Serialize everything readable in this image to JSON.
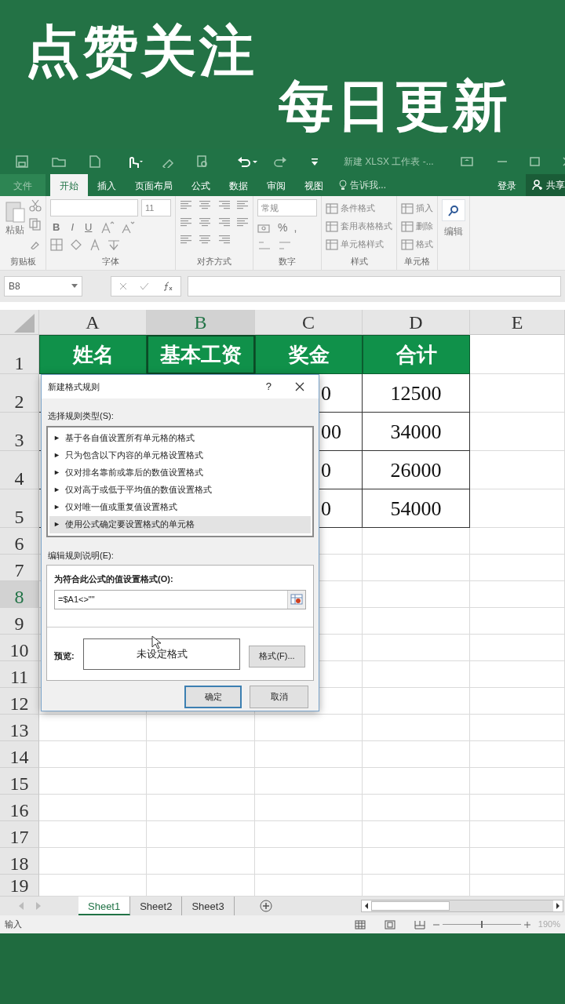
{
  "banner": {
    "lines": [
      "点赞关注",
      "每日更新"
    ]
  },
  "title_bar": {
    "title": "新建 XLSX 工作表 -..."
  },
  "ribbon_tabs": [
    {
      "label": "文件",
      "selected": false
    },
    {
      "label": "开始",
      "selected": true
    },
    {
      "label": "插入",
      "selected": false
    },
    {
      "label": "页面布局",
      "selected": false
    },
    {
      "label": "公式",
      "selected": false
    },
    {
      "label": "数据",
      "selected": false
    },
    {
      "label": "审阅",
      "selected": false
    },
    {
      "label": "视图",
      "selected": false
    }
  ],
  "tell_me": "告诉我...",
  "login": "登录",
  "share": "共享",
  "ribbon": {
    "groups": [
      {
        "kind": "clipboard",
        "label": "剪贴板",
        "paste": "粘贴"
      },
      {
        "kind": "font",
        "label": "字体",
        "size": "11",
        "styles": [
          "B",
          "I",
          "U"
        ]
      },
      {
        "kind": "align",
        "label": "对齐方式"
      },
      {
        "kind": "number",
        "label": "数字",
        "format": "常规",
        "symbols": [
          "%",
          ","
        ]
      },
      {
        "kind": "list",
        "label": "样式",
        "items": [
          "条件格式",
          "套用表格格式",
          "单元格样式"
        ]
      },
      {
        "kind": "list",
        "label": "单元格",
        "items": [
          "插入",
          "删除",
          "格式"
        ]
      },
      {
        "kind": "edit",
        "label": "编辑"
      }
    ]
  },
  "formula_bar": {
    "name_box": "B8"
  },
  "columns": [
    {
      "label": "A",
      "selected": false
    },
    {
      "label": "B",
      "selected": true
    },
    {
      "label": "C",
      "selected": false
    },
    {
      "label": "D",
      "selected": false
    },
    {
      "label": "E",
      "selected": false
    }
  ],
  "rows": [
    {
      "label": "1",
      "selected": false,
      "kind": "header",
      "cells": [
        "姓名",
        "基本工资",
        "奖金",
        "合计"
      ]
    },
    {
      "label": "2",
      "selected": false,
      "kind": "data",
      "cells": [
        null,
        null,
        "0",
        "12500"
      ]
    },
    {
      "label": "3",
      "selected": false,
      "kind": "data",
      "cells": [
        null,
        null,
        "00",
        "34000"
      ]
    },
    {
      "label": "4",
      "selected": false,
      "kind": "data",
      "cells": [
        null,
        null,
        "0",
        "26000"
      ]
    },
    {
      "label": "5",
      "selected": false,
      "kind": "data",
      "cells": [
        null,
        null,
        "0",
        "54000"
      ]
    },
    {
      "label": "6",
      "selected": false,
      "kind": "empty"
    },
    {
      "label": "7",
      "selected": false,
      "kind": "empty"
    },
    {
      "label": "8",
      "selected": true,
      "kind": "empty"
    },
    {
      "label": "9",
      "selected": false,
      "kind": "empty"
    },
    {
      "label": "10",
      "selected": false,
      "kind": "empty"
    },
    {
      "label": "11",
      "selected": false,
      "kind": "empty"
    },
    {
      "label": "12",
      "selected": false,
      "kind": "empty"
    },
    {
      "label": "13",
      "selected": false,
      "kind": "empty"
    },
    {
      "label": "14",
      "selected": false,
      "kind": "empty"
    },
    {
      "label": "15",
      "selected": false,
      "kind": "empty"
    },
    {
      "label": "16",
      "selected": false,
      "kind": "empty"
    },
    {
      "label": "17",
      "selected": false,
      "kind": "empty"
    },
    {
      "label": "18",
      "selected": false,
      "kind": "empty"
    },
    {
      "label": "19",
      "selected": false,
      "kind": "empty"
    }
  ],
  "sheet_tabs": [
    {
      "label": "Sheet1",
      "selected": true
    },
    {
      "label": "Sheet2",
      "selected": false
    },
    {
      "label": "Sheet3",
      "selected": false
    }
  ],
  "status_bar": {
    "mode": "输入",
    "zoom": "190%",
    "zoom_slider": {
      "level": 0.5
    }
  },
  "dialog": {
    "title": "新建格式规则",
    "help": "?",
    "rule_type_label": "选择规则类型(S):",
    "rule_types": [
      {
        "label": "基于各自值设置所有单元格的格式",
        "selected": false
      },
      {
        "label": "只为包含以下内容的单元格设置格式",
        "selected": false
      },
      {
        "label": "仅对排名靠前或靠后的数值设置格式",
        "selected": false
      },
      {
        "label": "仅对高于或低于平均值的数值设置格式",
        "selected": false
      },
      {
        "label": "仅对唯一值或重复值设置格式",
        "selected": false
      },
      {
        "label": "使用公式确定要设置格式的单元格",
        "selected": true
      }
    ],
    "marker": "►",
    "edit_label": "编辑规则说明(E):",
    "formula_label": "为符合此公式的值设置格式(O):",
    "formula": "=$A1<>\"\"",
    "preview_label": "预览:",
    "preview_text": "未设定格式",
    "format_button": "格式(F)...",
    "ok": "确定",
    "cancel": "取消"
  }
}
